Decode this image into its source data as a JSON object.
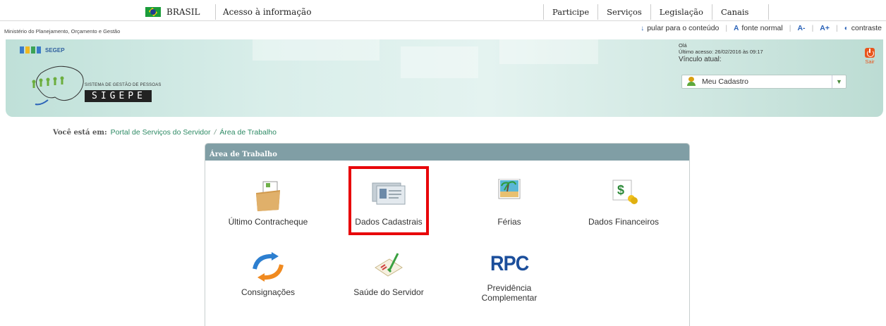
{
  "govbar": {
    "brasil_label": "BRASIL",
    "acesso_label": "Acesso à informação",
    "nav": [
      "Participe",
      "Serviços",
      "Legislação",
      "Canais"
    ]
  },
  "accbar": {
    "ministerio": "Ministério do Planejamento, Orçamento e Gestão",
    "links": [
      "pular para o conteúdo",
      "fonte normal",
      "A-",
      "A+",
      "contraste"
    ]
  },
  "header": {
    "segep_label": "SEGEP",
    "logo_subtitle": "SISTEMA DE GESTÃO DE PESSOAS",
    "logo_title": "SIGEPE",
    "user": {
      "greeting": "Olá",
      "last_access": "Último acesso: 26/02/2016 às 09:17",
      "vinculo_label": "Vínculo atual:",
      "selected": "Meu Cadastro"
    },
    "sair_label": "Sair"
  },
  "breadcrumb": {
    "prefix": "Você está em:",
    "link": "Portal de Serviços do Servidor",
    "separator": "/",
    "current": "Área de Trabalho"
  },
  "panel": {
    "title": "Área de Trabalho",
    "tiles": [
      {
        "label": "Último Contracheque",
        "icon": "folder-document-icon"
      },
      {
        "label": "Dados Cadastrais",
        "icon": "id-card-icon"
      },
      {
        "label": "Férias",
        "icon": "beach-picture-icon"
      },
      {
        "label": "Dados Financeiros",
        "icon": "money-dollar-icon"
      },
      {
        "label": "Consignações",
        "icon": "arrow-circle-icon"
      },
      {
        "label": "Saúde do Servidor",
        "icon": "health-check-icon"
      },
      {
        "label": "Previdência Complementar",
        "icon": "rpc-icon",
        "icon_text": "RPC"
      }
    ]
  },
  "colors": {
    "accent_green": "#2d8a64",
    "panel_head": "#809ea5",
    "highlight": "#e8050a",
    "rpc_blue": "#1b4e9b"
  }
}
